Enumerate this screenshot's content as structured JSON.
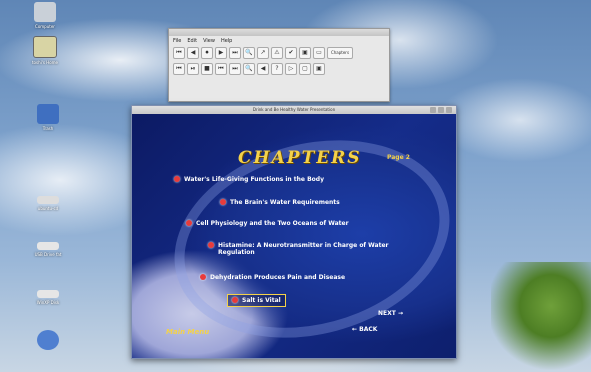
{
  "desktop": {
    "icons": [
      {
        "label": "Computer",
        "icon": "computer-icon",
        "color": "#c9d0d8"
      },
      {
        "label": "toshi's Home",
        "icon": "home-folder-icon",
        "color": "#d8d4a4"
      },
      {
        "label": "Trash",
        "icon": "trash-icon",
        "color": "#3f6fc0"
      },
      {
        "label": "ubuntu-cd",
        "icon": "cd-drive-icon",
        "color": "#dddddd"
      },
      {
        "label": "USB Drive fat",
        "icon": "usb-drive-icon",
        "color": "#e6e6e6"
      },
      {
        "label": "WinXP Disk",
        "icon": "disk-drive-icon",
        "color": "#e6e6e6"
      },
      {
        "label": "",
        "icon": "network-globe-icon",
        "color": "#4f7fd0"
      }
    ]
  },
  "toolbar_window": {
    "menu": [
      "File",
      "Edit",
      "View",
      "Help"
    ],
    "row1": [
      "⏮",
      "◀",
      "⏺",
      "▶",
      "⏭",
      "🔍",
      "↗",
      "⚠",
      "✔",
      "▣",
      "▭"
    ],
    "row1_extra": "Chapters",
    "row2": [
      "⏮",
      "⏯",
      "■",
      "⏮",
      "⏭",
      "🔍",
      "◀",
      "?",
      "▷",
      "▢",
      "▣"
    ]
  },
  "main_window": {
    "title": "Drink and Be Healthy Water Presentation",
    "heading": "CHAPTERS",
    "page": "Page 2",
    "items": [
      "Water's Life-Giving Functions in the Body",
      "The Brain's Water Requirements",
      "Cell Physiology and the Two Oceans of Water",
      "Histamine:  A Neurotransmitter in Charge of Water Regulation",
      "Dehydration Produces Pain and Disease",
      "Salt is Vital"
    ],
    "main_menu": "Main Menu",
    "next": "NEXT",
    "back": "BACK"
  }
}
